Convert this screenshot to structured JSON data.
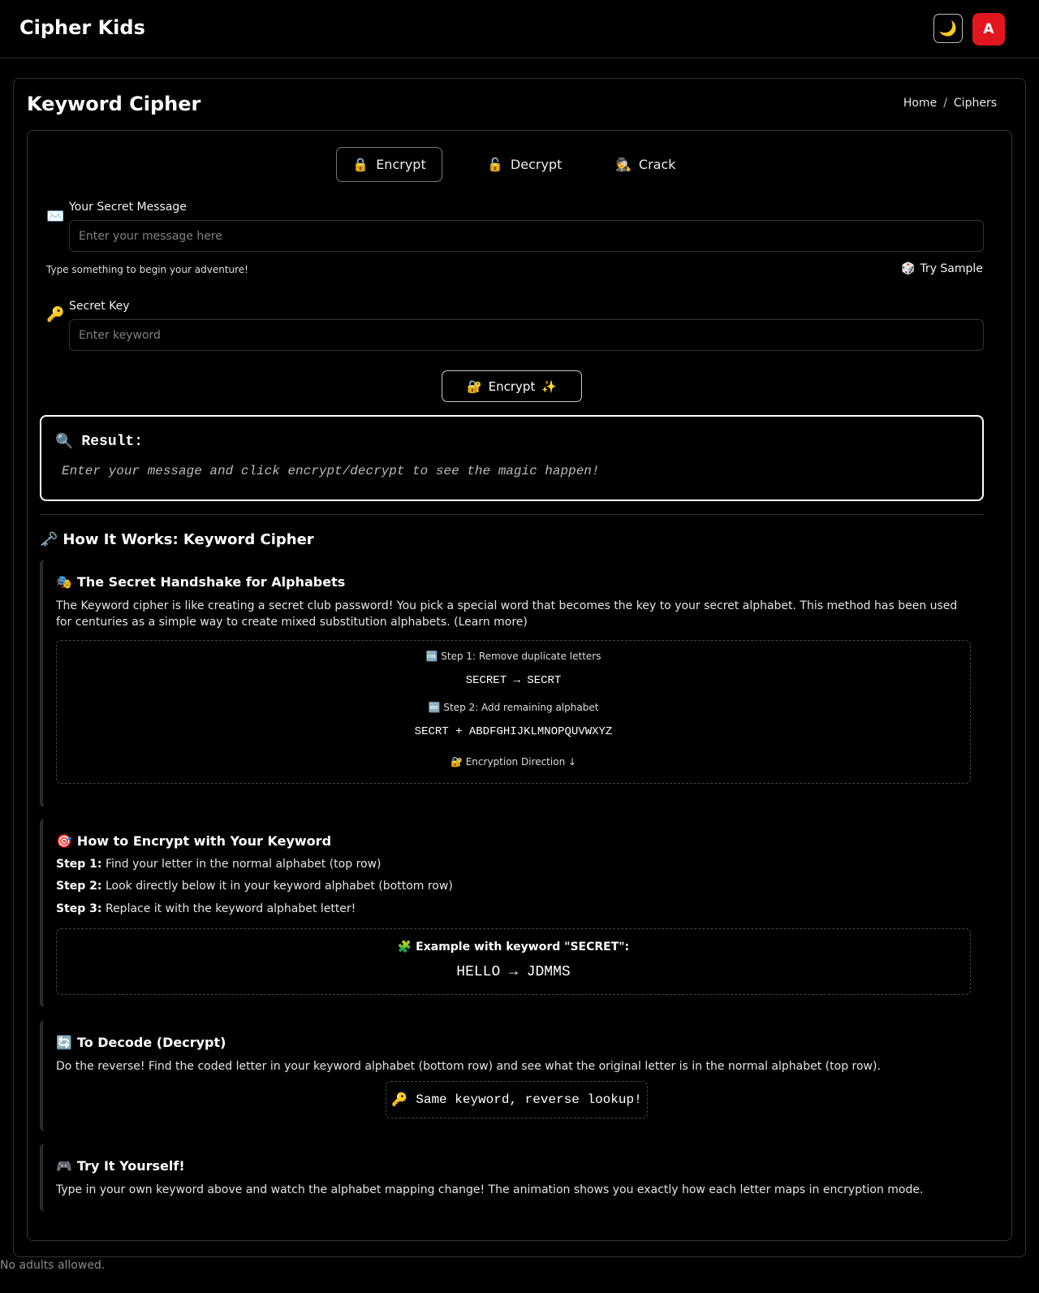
{
  "header": {
    "brand": "Cipher Kids",
    "theme_icon": "moon-icon",
    "theme_glyph": "🌙",
    "avatar_letter": "A",
    "avatar_color": "#e2161e"
  },
  "page": {
    "title": "Keyword Cipher",
    "breadcrumb": {
      "home": "Home",
      "separator": "/",
      "current": "Ciphers"
    }
  },
  "tabs": [
    {
      "label": "Encrypt",
      "icon": "🔒",
      "active": true
    },
    {
      "label": "Decrypt",
      "icon": "🔓",
      "active": false
    },
    {
      "label": "Crack",
      "icon": "🕵️",
      "active": false
    }
  ],
  "message_field": {
    "icon": "✉️",
    "label": "Your Secret Message",
    "placeholder": "Enter your message here",
    "value": "",
    "hint": "Type something to begin your adventure!",
    "try_sample_icon": "🎲",
    "try_sample_label": "Try Sample"
  },
  "key_field": {
    "icon": "🔑",
    "label": "Secret Key",
    "placeholder": "Enter keyword",
    "value": ""
  },
  "action_button": {
    "icon_left": "🔐",
    "label": "Encrypt",
    "icon_right": "✨"
  },
  "result": {
    "icon": "🔍",
    "title": "Result:",
    "text": "Enter your message and click encrypt/decrypt to see the magic happen!"
  },
  "how_it_works": {
    "icon": "🗝️",
    "title": "How It Works: Keyword Cipher",
    "sections": {
      "handshake": {
        "icon": "🎭",
        "title": "The Secret Handshake for Alphabets",
        "text": "The Keyword cipher is like creating a secret club password! You pick a special word that becomes the key to your secret alphabet. This method has been used for centuries as a simple way to create mixed substitution alphabets. (Learn more)",
        "step1_icon": "🆒",
        "step1_label": "Step 1: Remove duplicate letters",
        "step1_value": "SECRET → SECRT",
        "step2_icon": "🔤",
        "step2_label": "Step 2: Add remaining alphabet",
        "step2_value": "SECRT + ABDFGHIJKLMNOPQUVWXYZ",
        "direction_icon": "🔐",
        "direction_label": "Encryption Direction ↓"
      },
      "encrypt": {
        "icon": "🎯",
        "title": "How to Encrypt with Your Keyword",
        "steps": [
          {
            "label": "Step 1:",
            "text": "Find your letter in the normal alphabet (top row)"
          },
          {
            "label": "Step 2:",
            "text": "Look directly below it in your keyword alphabet (bottom row)"
          },
          {
            "label": "Step 3:",
            "text": "Replace it with the keyword alphabet letter!"
          }
        ],
        "example_icon": "🧩",
        "example_label": "Example with keyword \"SECRET\":",
        "example_value": "HELLO → JDMMS"
      },
      "decode": {
        "icon": "🔄",
        "title": "To Decode (Decrypt)",
        "text": "Do the reverse! Find the coded letter in your keyword alphabet (bottom row) and see what the original letter is in the normal alphabet (top row).",
        "badge_icon": "🔑",
        "badge_text": "Same keyword, reverse lookup!"
      },
      "try": {
        "icon": "🎮",
        "title": "Try It Yourself!",
        "text": "Type in your own keyword above and watch the alphabet mapping change! The animation shows you exactly how each letter maps in encryption mode."
      }
    }
  },
  "footer": {
    "text": "No adults allowed."
  }
}
